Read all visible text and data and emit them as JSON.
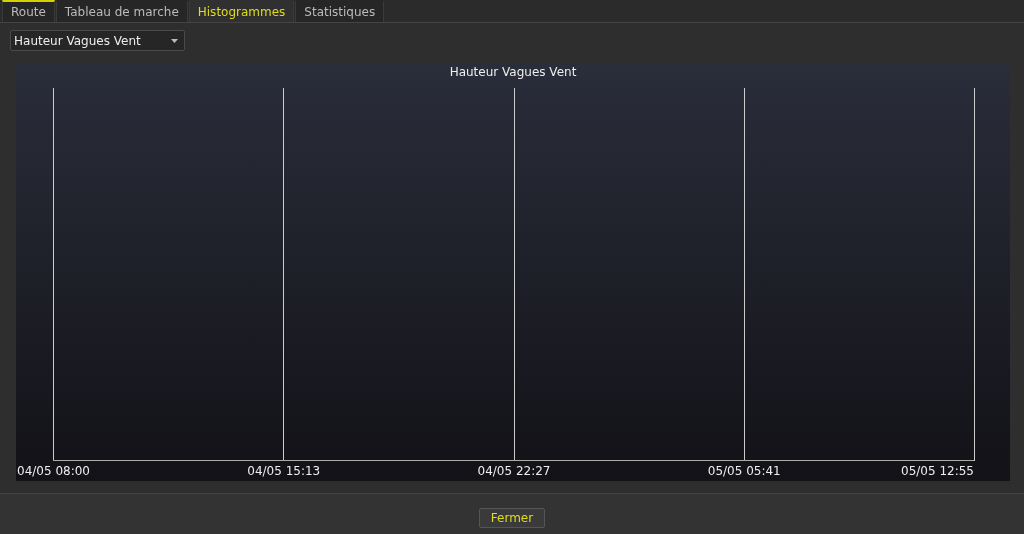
{
  "tabs": [
    {
      "label": "Route",
      "selected": false,
      "focused": true
    },
    {
      "label": "Tableau de marche",
      "selected": false,
      "focused": false
    },
    {
      "label": "Histogrammes",
      "selected": true,
      "focused": false
    },
    {
      "label": "Statistiques",
      "selected": false,
      "focused": false
    }
  ],
  "dropdown": {
    "value": "Hauteur Vagues Vent"
  },
  "chart": {
    "title": "Hauteur Vagues Vent",
    "x_labels": [
      "04/05 08:00",
      "04/05 15:13",
      "04/05 22:27",
      "05/05 05:41",
      "05/05 12:55"
    ]
  },
  "buttons": [
    "Fermer"
  ]
}
